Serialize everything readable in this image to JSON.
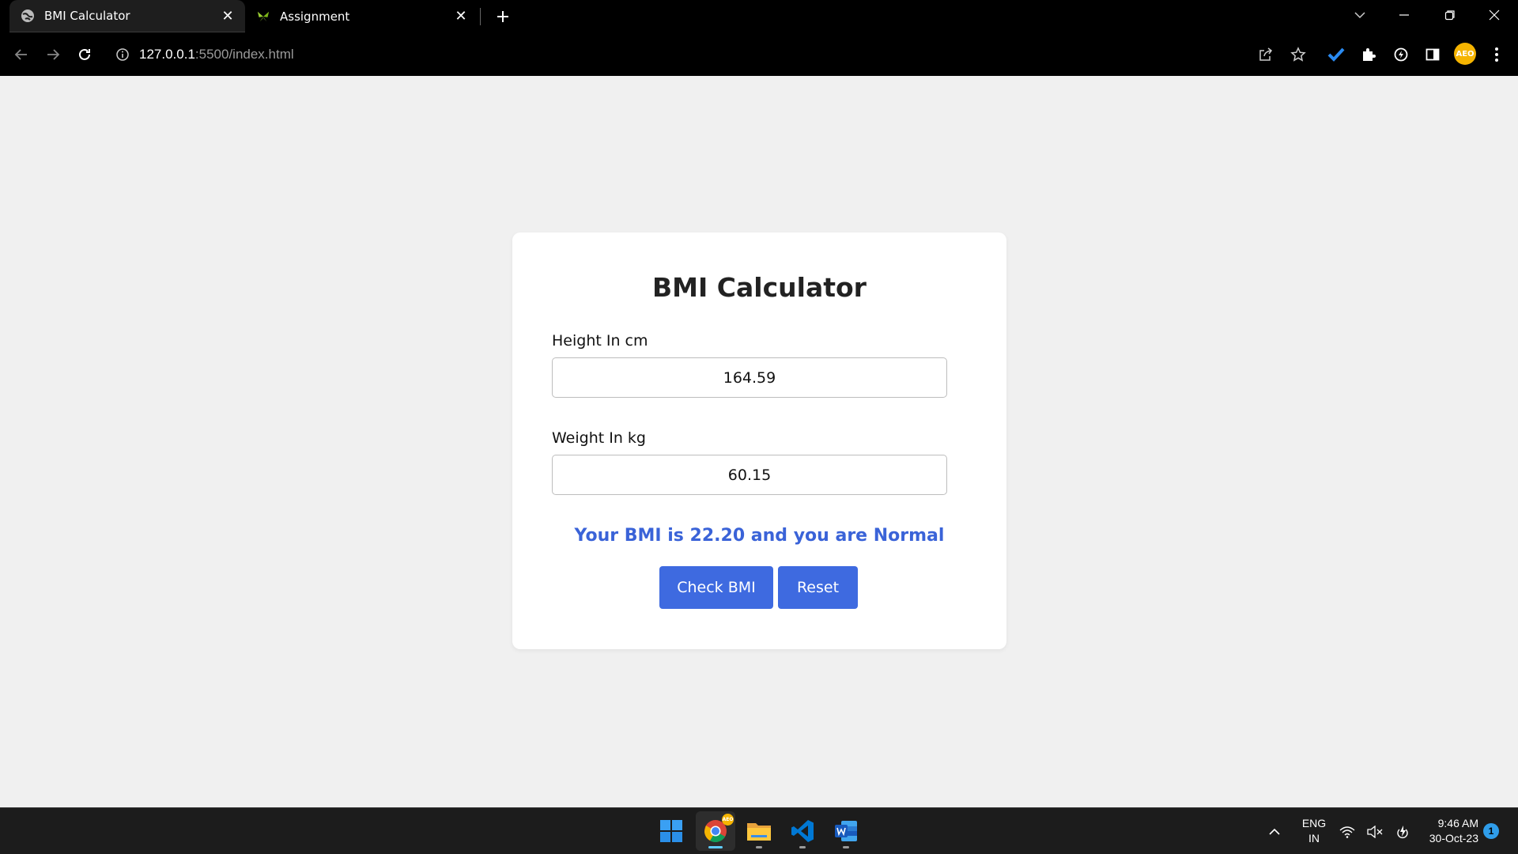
{
  "browser": {
    "tabs": [
      {
        "title": "BMI Calculator",
        "active": true,
        "icon": "globe-icon"
      },
      {
        "title": "Assignment",
        "active": false,
        "icon": "butterfly-icon"
      }
    ],
    "url": {
      "host": "127.0.0.1",
      "path": ":5500/index.html"
    },
    "profile_initials": "AEO",
    "accent": "#3e6ae0"
  },
  "page": {
    "title": "BMI Calculator",
    "height": {
      "label": "Height In cm",
      "value": "164.59"
    },
    "weight": {
      "label": "Weight In kg",
      "value": "60.15"
    },
    "result": "Your BMI is 22.20 and you are Normal",
    "check_button": "Check BMI",
    "reset_button": "Reset"
  },
  "taskbar": {
    "lang_top": "ENG",
    "lang_bottom": "IN",
    "time": "9:46 AM",
    "date": "30-Oct-23",
    "notification_count": "1",
    "chrome_badge": "AEO"
  }
}
